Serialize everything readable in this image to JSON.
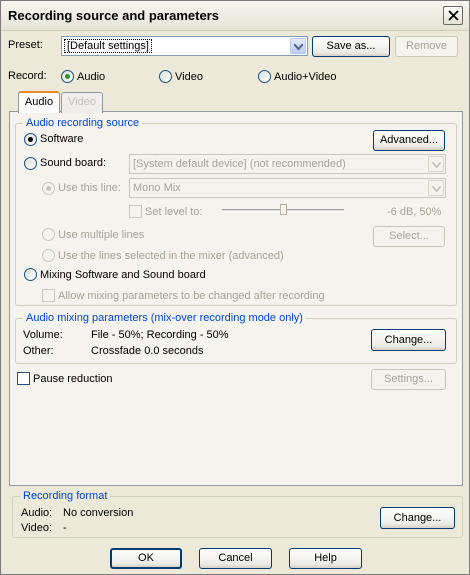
{
  "window": {
    "title": "Recording source and parameters"
  },
  "preset": {
    "label": "Preset:",
    "value": "[Default settings]",
    "save_as": "Save as...",
    "remove": "Remove"
  },
  "record": {
    "label": "Record:",
    "options": [
      "Audio",
      "Video",
      "Audio+Video"
    ],
    "selected": "Audio"
  },
  "tabs": [
    "Audio",
    "Video"
  ],
  "audio_source": {
    "title": "Audio recording source",
    "software": "Software",
    "advanced": "Advanced...",
    "sound_board": "Sound board:",
    "sound_board_value": "[System default device] (not recommended)",
    "use_this_line": "Use this line:",
    "line_value": "Mono Mix",
    "set_level": "Set level to:",
    "level_readout": "-6 dB, 50%",
    "level_fraction": 0.5,
    "use_multiple_lines": "Use multiple lines",
    "select": "Select...",
    "use_mixer_lines": "Use the lines selected in the mixer (advanced)",
    "mixing": "Mixing Software and Sound board",
    "allow_mixing": "Allow mixing parameters to be changed after recording"
  },
  "mixing_params": {
    "title": "Audio mixing parameters (mix-over recording mode only)",
    "volume_label": "Volume:",
    "volume_value": "File - 50%; Recording - 50%",
    "other_label": "Other:",
    "other_value": "Crossfade 0.0 seconds",
    "change": "Change..."
  },
  "pause": {
    "label": "Pause reduction",
    "settings": "Settings..."
  },
  "format": {
    "title": "Recording format",
    "audio_label": "Audio:",
    "audio_value": "No conversion",
    "video_label": "Video:",
    "video_value": "-",
    "change": "Change..."
  },
  "footer": {
    "ok": "OK",
    "cancel": "Cancel",
    "help": "Help"
  }
}
